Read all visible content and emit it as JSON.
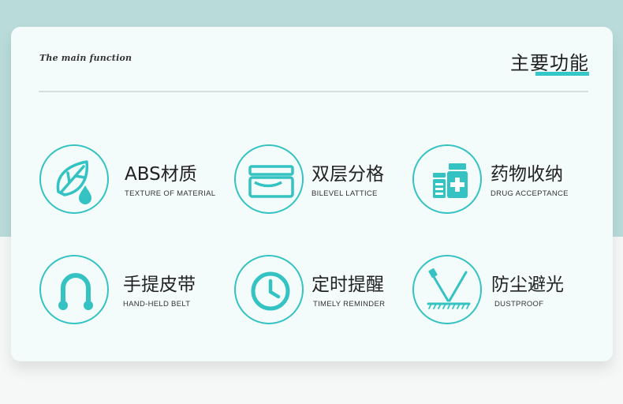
{
  "header": {
    "subtitle": "The main function",
    "title": "主要功能"
  },
  "features": [
    {
      "name": "ABS材质",
      "desc": "TEXTURE OF MATERIAL",
      "icon": "leaf-water-icon"
    },
    {
      "name": "双层分格",
      "desc": "BILEVEL LATTICE",
      "icon": "layered-box-icon"
    },
    {
      "name": "药物收纳",
      "desc": "DRUG ACCEPTANCE",
      "icon": "medicine-bottles-icon"
    },
    {
      "name": "手提皮带",
      "desc": "HAND-HELD BELT",
      "icon": "handle-strap-icon"
    },
    {
      "name": "定时提醒",
      "desc": "TIMELY REMINDER",
      "icon": "clock-icon"
    },
    {
      "name": "防尘避光",
      "desc": "DUSTPROOF",
      "icon": "dustproof-icon"
    }
  ],
  "colors": {
    "accent": "#34c2c2",
    "background_top": "#b9dcdb",
    "card": "#f3fcfb"
  }
}
